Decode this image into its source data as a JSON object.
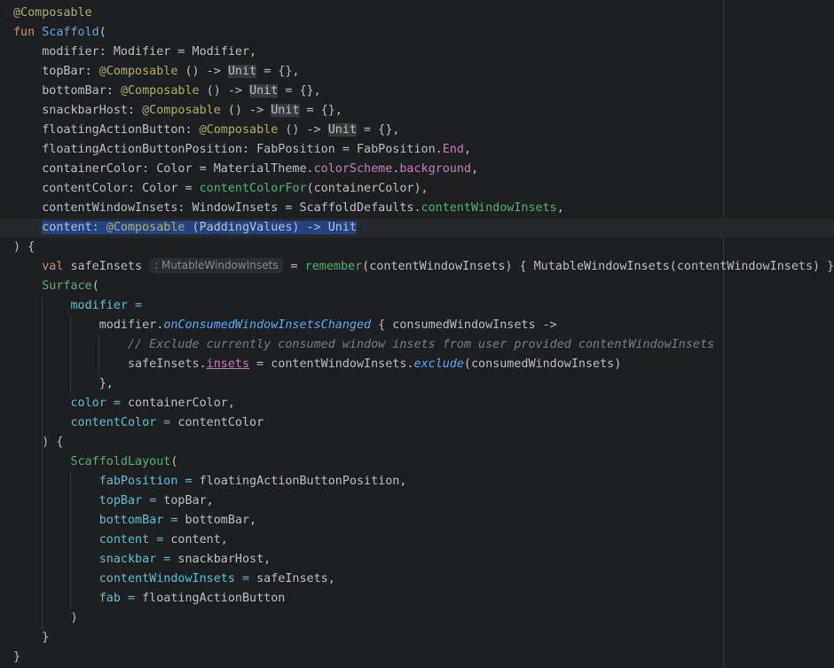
{
  "code": [
    [
      {
        "t": "@Composable",
        "c": "ann"
      }
    ],
    [
      {
        "t": "fun",
        "c": "kw"
      },
      {
        "t": " "
      },
      {
        "t": "Scaffold",
        "c": "fn"
      },
      {
        "t": "("
      }
    ],
    [
      {
        "t": "    modifier: Modifier = Modifier,"
      }
    ],
    [
      {
        "t": "    topBar: "
      },
      {
        "t": "@Composable",
        "c": "ann"
      },
      {
        "t": " () -> "
      },
      {
        "t": "Unit",
        "c": "hl-unit"
      },
      {
        "t": " = {},"
      }
    ],
    [
      {
        "t": "    bottomBar: "
      },
      {
        "t": "@Composable",
        "c": "ann"
      },
      {
        "t": " () -> "
      },
      {
        "t": "Unit",
        "c": "hl-unit"
      },
      {
        "t": " = {},"
      }
    ],
    [
      {
        "t": "    snackbarHost: "
      },
      {
        "t": "@Composable",
        "c": "ann"
      },
      {
        "t": " () -> "
      },
      {
        "t": "Unit",
        "c": "hl-unit"
      },
      {
        "t": " = {},"
      }
    ],
    [
      {
        "t": "    floatingActionButton: "
      },
      {
        "t": "@Composable",
        "c": "ann"
      },
      {
        "t": " () -> "
      },
      {
        "t": "Unit",
        "c": "hl-unit"
      },
      {
        "t": " = {},"
      }
    ],
    [
      {
        "t": "    floatingActionButtonPosition: FabPosition = FabPosition."
      },
      {
        "t": "End",
        "c": "prop"
      },
      {
        "t": ","
      }
    ],
    [
      {
        "t": "    containerColor: Color = MaterialTheme."
      },
      {
        "t": "colorScheme",
        "c": "prop"
      },
      {
        "t": "."
      },
      {
        "t": "background",
        "c": "prop"
      },
      {
        "t": ","
      }
    ],
    [
      {
        "t": "    contentColor: Color = "
      },
      {
        "t": "contentColorFor",
        "c": "green"
      },
      {
        "t": "(containerColor),"
      }
    ],
    [
      {
        "t": "    contentWindowInsets: WindowInsets = ScaffoldDefaults."
      },
      {
        "t": "contentWindowInsets",
        "c": "green"
      },
      {
        "t": ","
      }
    ],
    [
      {
        "t": "    "
      },
      {
        "t": "content: ",
        "c": "sel"
      },
      {
        "t": "@Composable",
        "c": "ann sel"
      },
      {
        "t": " (PaddingValues) -> Unit",
        "c": "sel"
      }
    ],
    [
      {
        "t": ") {"
      }
    ],
    [
      {
        "t": "    "
      },
      {
        "t": "val",
        "c": "kw"
      },
      {
        "t": " safeInsets "
      },
      {
        "t": ": MutableWindowInsets",
        "c": "hint"
      },
      {
        "t": " = "
      },
      {
        "t": "remember",
        "c": "green"
      },
      {
        "t": "(contentWindowInsets) { MutableWindowInsets(contentWindowInsets) }"
      }
    ],
    [
      {
        "t": "    "
      },
      {
        "t": "Surface",
        "c": "green"
      },
      {
        "t": "("
      }
    ],
    [
      {
        "t": "        "
      },
      {
        "t": "modifier =",
        "c": "named"
      }
    ],
    [
      {
        "t": "            modifier."
      },
      {
        "t": "onConsumedWindowInsetsChanged",
        "c": "ext"
      },
      {
        "t": " { consumedWindowInsets ->"
      }
    ],
    [
      {
        "t": "                "
      },
      {
        "t": "// Exclude currently consumed window insets from user provided contentWindowInsets",
        "c": "cmt"
      }
    ],
    [
      {
        "t": "                safeInsets."
      },
      {
        "t": "insets",
        "c": "prop ul"
      },
      {
        "t": " = contentWindowInsets."
      },
      {
        "t": "exclude",
        "c": "ext"
      },
      {
        "t": "(consumedWindowInsets)"
      }
    ],
    [
      {
        "t": "            },"
      }
    ],
    [
      {
        "t": "        "
      },
      {
        "t": "color =",
        "c": "named"
      },
      {
        "t": " containerColor,"
      }
    ],
    [
      {
        "t": "        "
      },
      {
        "t": "contentColor =",
        "c": "named"
      },
      {
        "t": " contentColor"
      }
    ],
    [
      {
        "t": "    ) {"
      }
    ],
    [
      {
        "t": "        "
      },
      {
        "t": "ScaffoldLayout",
        "c": "green"
      },
      {
        "t": "("
      }
    ],
    [
      {
        "t": "            "
      },
      {
        "t": "fabPosition =",
        "c": "named"
      },
      {
        "t": " floatingActionButtonPosition,"
      }
    ],
    [
      {
        "t": "            "
      },
      {
        "t": "topBar =",
        "c": "named"
      },
      {
        "t": " topBar,"
      }
    ],
    [
      {
        "t": "            "
      },
      {
        "t": "bottomBar =",
        "c": "named"
      },
      {
        "t": " bottomBar,"
      }
    ],
    [
      {
        "t": "            "
      },
      {
        "t": "content =",
        "c": "named"
      },
      {
        "t": " content,"
      }
    ],
    [
      {
        "t": "            "
      },
      {
        "t": "snackbar =",
        "c": "named"
      },
      {
        "t": " snackbarHost,"
      }
    ],
    [
      {
        "t": "            "
      },
      {
        "t": "contentWindowInsets =",
        "c": "named"
      },
      {
        "t": " safeInsets,"
      }
    ],
    [
      {
        "t": "            "
      },
      {
        "t": "fab =",
        "c": "named"
      },
      {
        "t": " floatingActionButton"
      }
    ],
    [
      {
        "t": "        )"
      }
    ],
    [
      {
        "t": "    }"
      }
    ],
    [
      {
        "t": "}"
      }
    ]
  ],
  "caret_line": 11,
  "colors": {
    "background": "#1e1f22",
    "text": "#bcbec4",
    "keyword": "#cf8e6d",
    "annotation": "#b3ae60",
    "function_declaration": "#56a8f5",
    "property": "#c77dbb",
    "named_argument": "#56c1d6",
    "composable_call": "#4fb36b",
    "comment": "#7a7e85",
    "selection": "#214283"
  }
}
